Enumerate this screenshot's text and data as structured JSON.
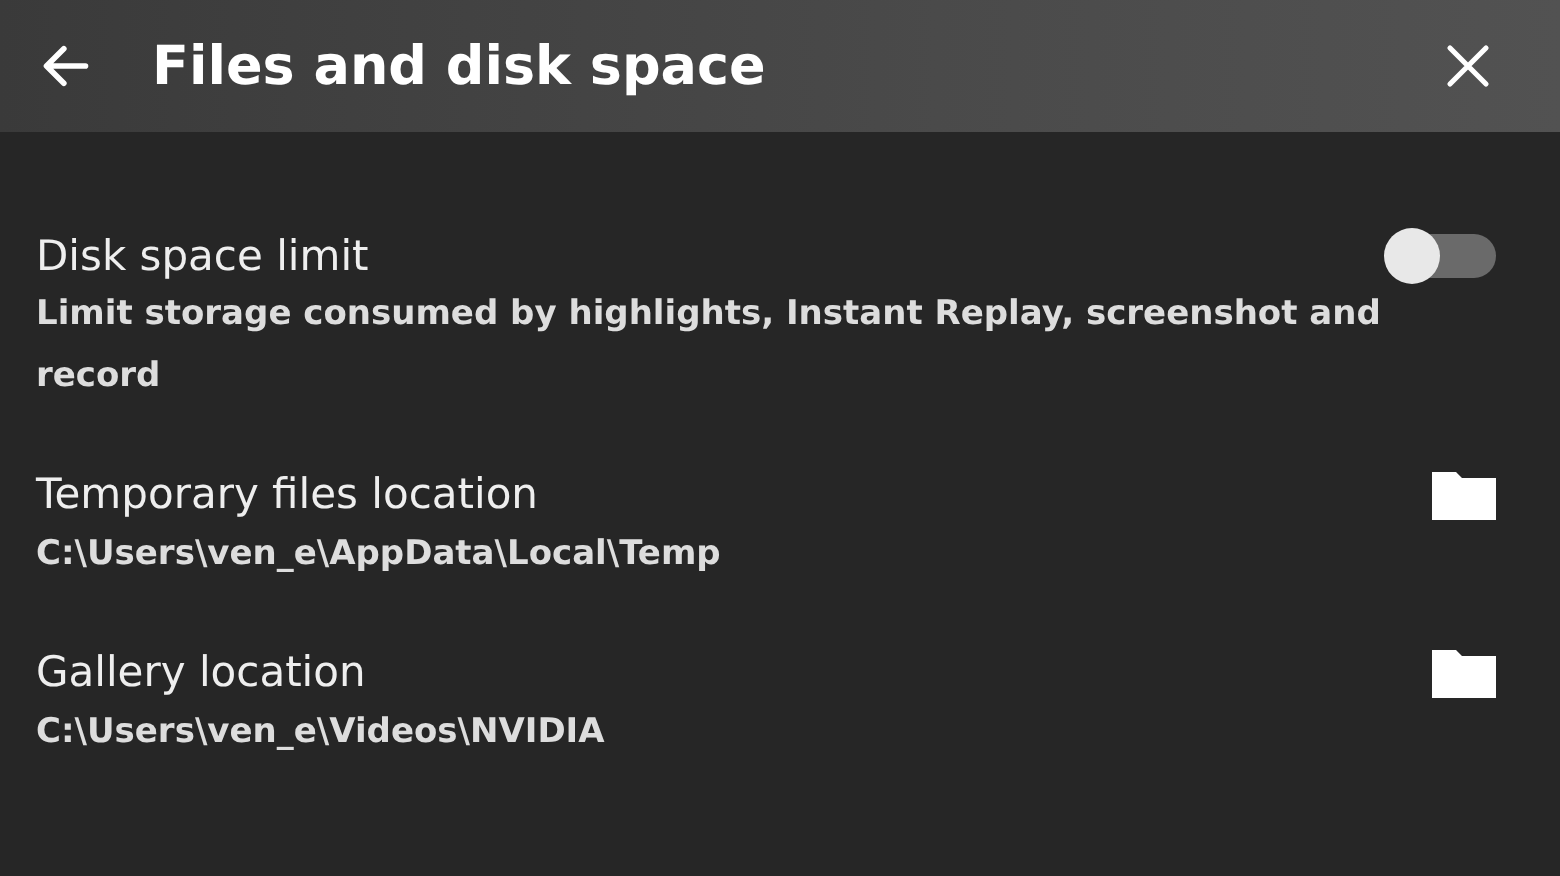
{
  "header": {
    "title": "Files and disk space"
  },
  "settings": [
    {
      "kind": "toggle",
      "label": "Disk space limit",
      "description": "Limit storage consumed by highlights, Instant Replay, screenshot and record",
      "on": false
    },
    {
      "kind": "folder",
      "label": "Temporary files location",
      "description": "C:\\Users\\ven_e\\AppData\\Local\\Temp"
    },
    {
      "kind": "folder",
      "label": "Gallery location",
      "description": "C:\\Users\\ven_e\\Videos\\NVIDIA"
    }
  ]
}
